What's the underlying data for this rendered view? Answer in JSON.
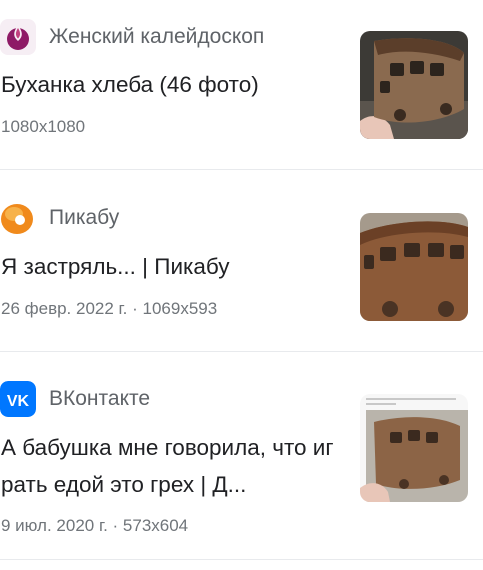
{
  "results": [
    {
      "source": "Женский калейдоскоп",
      "title": "Буханка хлеба (46 фото)",
      "meta": "1080x1080",
      "favicon": "kaleidoscope-logo-icon",
      "image": "bread-loaf-bus-photo"
    },
    {
      "source": "Пикабу",
      "title": "Я застряль... | Пикабу",
      "meta": "26 февр. 2022 г. · 1069x593",
      "favicon": "pikabu-logo-icon",
      "image": "bread-loaf-bus-photo"
    },
    {
      "source": "ВКонтакте",
      "title": "А бабушка мне говорила, что играть едой это грех | Д...",
      "meta": "9 июл. 2020 г. · 573x604",
      "favicon": "vk-logo-icon",
      "image": "bread-loaf-bus-screenshot"
    }
  ]
}
